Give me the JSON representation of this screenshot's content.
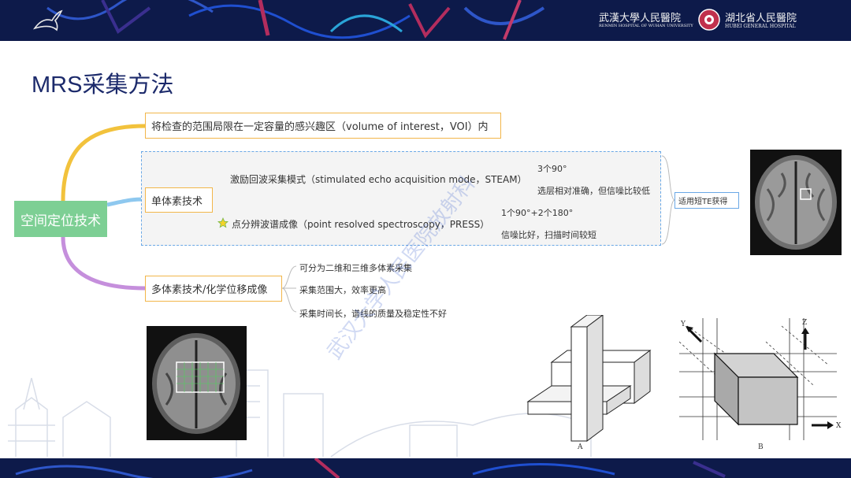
{
  "header": {
    "hospital_left_cn": "武漢大學人民醫院",
    "hospital_left_en": "RENMIN HOSPITAL OF WUHAN UNIVERSITY",
    "hospital_right_cn": "湖北省人民醫院",
    "hospital_right_en": "HUBEI   GENERAL   HOSPITAL"
  },
  "title": "MRS采集方法",
  "mindmap": {
    "root": "空间定位技术",
    "branch_voi": "将检查的范围局限在一定容量的感兴趣区（volume of interest，VOI）内",
    "branch_single": "单体素技术",
    "steam": "激励回波采集模式（stimulated echo acquisition mode，STEAM）",
    "steam_notes": [
      "3个90°",
      "选层相对准确，但信噪比较低"
    ],
    "press": "点分辨波谱成像（point resolved spectroscopy，PRESS）",
    "press_notes": [
      "1个90°+2个180°",
      "信噪比好，扫描时间较短"
    ],
    "single_note": "适用短TE获得",
    "branch_multi": "多体素技术/化学位移成像",
    "multi_notes": [
      "可分为二维和三维多体素采集",
      "采集范围大，效率更高",
      "采集时间长，谱线的质量及稳定性不好"
    ]
  },
  "figure_labels": {
    "a": "A",
    "b": "B",
    "axis_x": "X",
    "axis_y": "Y",
    "axis_z": "Z"
  },
  "watermark": "武汉大学人民医院放射科",
  "colors": {
    "band": "#0d1a4a",
    "title": "#1c2a6b",
    "root_fill": "#7dcf94",
    "voi_line": "#f2b64a",
    "single_line": "#6aa8e6",
    "multi_line": "#c58fdc",
    "box_border": "#f2b64a"
  }
}
